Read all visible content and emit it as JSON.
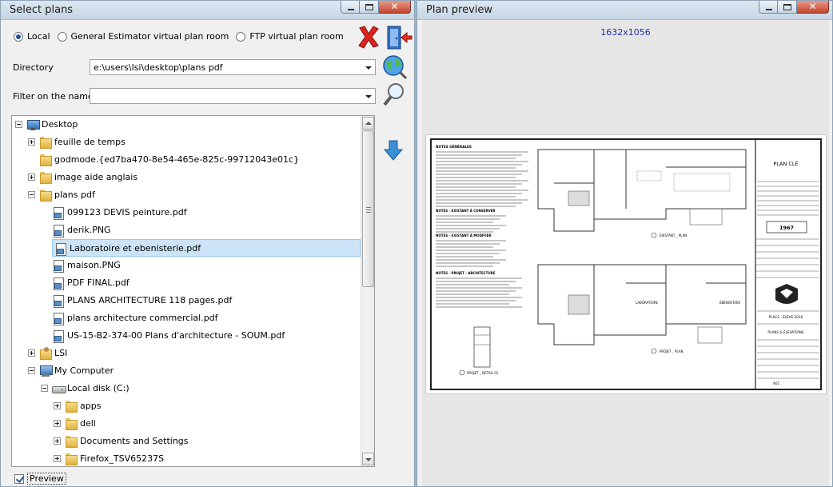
{
  "left_window": {
    "title": "Select plans",
    "source_options": [
      {
        "label": "Local",
        "selected": true
      },
      {
        "label": "General Estimator virtual plan room",
        "selected": false
      },
      {
        "label": "FTP virtual plan room",
        "selected": false
      }
    ],
    "directory_label": "Directory",
    "directory_value": "e:\\users\\lsi\\desktop\\plans pdf",
    "filter_label": "Filter on the name",
    "filter_value": "",
    "tree": [
      {
        "label": "Desktop",
        "icon": "desktop-icon",
        "expanded": true,
        "level": 0
      },
      {
        "label": "feuille de temps",
        "icon": "folder-icon",
        "expanded": false,
        "level": 1
      },
      {
        "label": "godmode.{ed7ba470-8e54-465e-825c-99712043e01c}",
        "icon": "folder-icon",
        "level": 1
      },
      {
        "label": "image aide anglais",
        "icon": "folder-icon",
        "expanded": false,
        "level": 1
      },
      {
        "label": "plans pdf",
        "icon": "folder-icon",
        "expanded": true,
        "level": 1
      },
      {
        "label": "099123 DEVIS peinture.pdf",
        "icon": "file-icon",
        "level": 2
      },
      {
        "label": "derik.PNG",
        "icon": "file-icon",
        "level": 2
      },
      {
        "label": "Laboratoire et ebenisterie.pdf",
        "icon": "file-icon",
        "level": 2,
        "selected": true
      },
      {
        "label": "maison.PNG",
        "icon": "file-icon",
        "level": 2
      },
      {
        "label": "PDF FINAL.pdf",
        "icon": "file-icon",
        "level": 2
      },
      {
        "label": "PLANS ARCHITECTURE 118 pages.pdf",
        "icon": "file-icon",
        "level": 2
      },
      {
        "label": "plans architecture commercial.pdf",
        "icon": "file-icon",
        "level": 2
      },
      {
        "label": "US-15-B2-374-00 Plans d'architecture - SOUM.pdf",
        "icon": "file-icon",
        "level": 2
      },
      {
        "label": "LSI",
        "icon": "user-folder-icon",
        "expanded": false,
        "level": 1
      },
      {
        "label": "My Computer",
        "icon": "computer-icon",
        "expanded": true,
        "level": 1
      },
      {
        "label": "Local disk (C:)",
        "icon": "disk-icon",
        "expanded": true,
        "level": 2
      },
      {
        "label": "apps",
        "icon": "folder-icon",
        "expanded": false,
        "level": 3
      },
      {
        "label": "dell",
        "icon": "folder-icon",
        "expanded": false,
        "level": 3
      },
      {
        "label": "Documents and Settings",
        "icon": "folder-icon",
        "expanded": false,
        "level": 3
      },
      {
        "label": "Firefox_TSV65237S",
        "icon": "folder-icon",
        "expanded": false,
        "level": 3
      }
    ],
    "preview_checkbox_label": "Preview",
    "preview_checked": true
  },
  "right_window": {
    "title": "Plan preview",
    "dimensions": "1632x1056",
    "sheet": {
      "notes_title": "NOTES GÉNÉRALES",
      "keep_title": "NOTES - EXISTANT À CONSERVER",
      "modify_title": "NOTES - EXISTANT À MODIFIER",
      "project_title": "NOTES - PROJET - ARCHITECTURE",
      "key_plan": "PLAN CLÉ",
      "year": "1967",
      "existing_label": "EXISTANT _ PLAN",
      "project_label": "PROJET _ PLAN",
      "detail_label": "PROJET _ DETAIL 01",
      "room_lab": "LABORATOIRE",
      "room_cab": "ÉBÉNISTERIE",
      "place": "PLACE - ÉLÈVE 2016",
      "drawing_title": "PLANS & ÉLÉVATIONS",
      "sheet_no": "A01"
    }
  },
  "colors": {
    "title_bar": "#c6d6e5",
    "window_bg": "#f0f0f0",
    "selection_bg": "#cce4f7",
    "dimension_text": "#1c2fa0"
  }
}
